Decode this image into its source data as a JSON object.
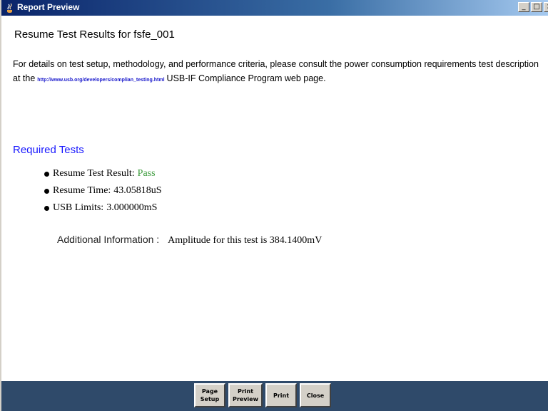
{
  "window": {
    "title": "Report Preview",
    "controls": {
      "minimize": "_",
      "maximize": "□",
      "close": "×"
    }
  },
  "report": {
    "heading": "Resume Test Results for fsfe_001",
    "intro_before": "For details on test setup, methodology, and performance criteria, please consult the power consumption requirements test description at the",
    "intro_link": "http://www.usb.org/developers/complian_testing.html",
    "intro_after": "USB-IF Compliance Program web page.",
    "section_title": "Required Tests",
    "results": [
      {
        "label": "Resume Test Result:",
        "value": "Pass"
      },
      {
        "label": "Resume Time:",
        "value": "43.05818uS"
      },
      {
        "label": "USB Limits:",
        "value": "3.000000mS"
      }
    ],
    "additional_label": "Additional Information :",
    "additional_value": "Amplitude for this test is 384.1400mV"
  },
  "buttons": {
    "page_setup": [
      "Page",
      "Setup"
    ],
    "print_preview": [
      "Print",
      "Preview"
    ],
    "print": "Print",
    "close": "Close"
  },
  "colors": {
    "pass": "#3a9a3a",
    "section_title": "#1a1aff",
    "link": "#1a1acc",
    "footer": "#2f4a6a"
  },
  "icons": {
    "app_icon": "java-coffee-icon"
  }
}
